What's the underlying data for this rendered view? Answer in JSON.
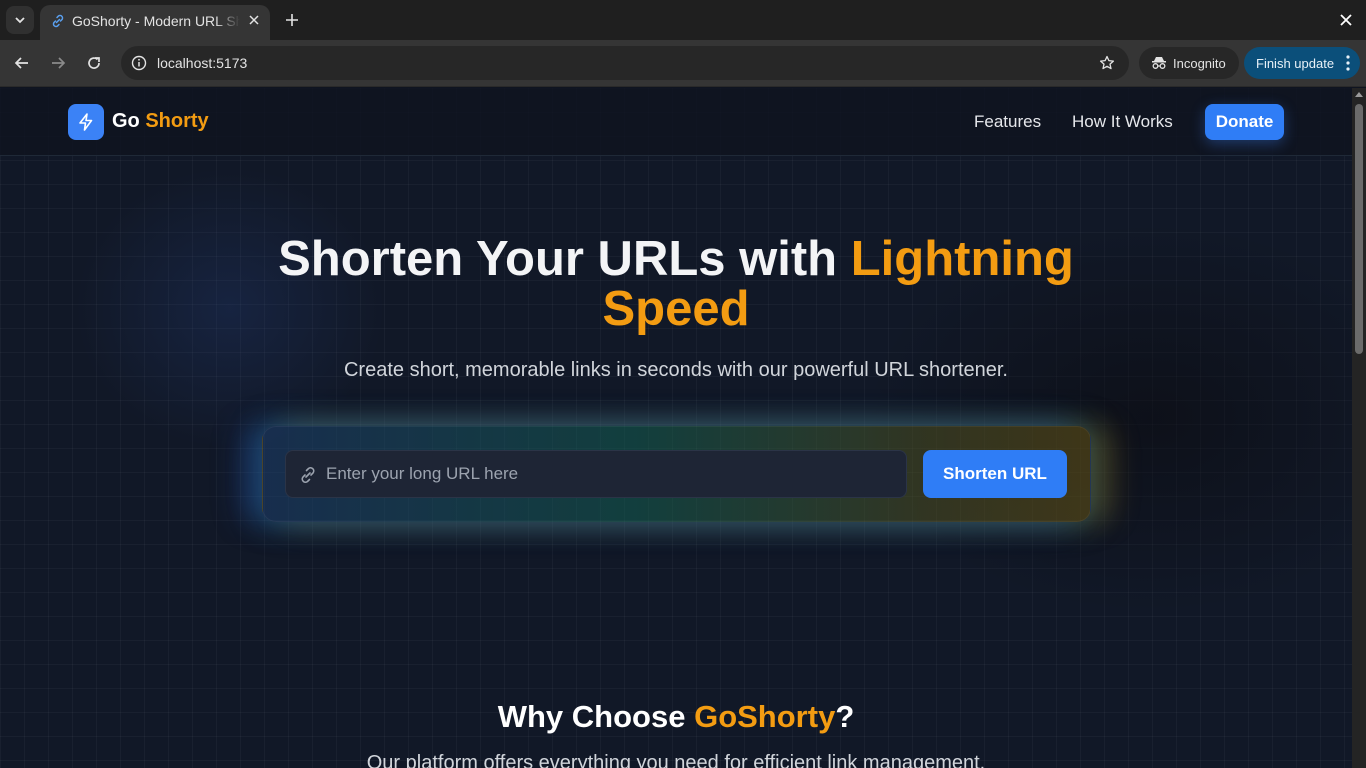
{
  "browser": {
    "tab_title": "GoShorty - Modern URL Shortener",
    "url": "localhost:5173",
    "incognito_label": "Incognito",
    "update_label": "Finish update",
    "icons": [
      "tab-search-icon",
      "link-favicon-icon",
      "close-icon",
      "plus-icon",
      "back-icon",
      "forward-icon",
      "reload-icon",
      "info-icon",
      "star-icon",
      "incognito-icon",
      "kebab-menu-icon"
    ]
  },
  "header": {
    "logo_prefix": "Go",
    "logo_accent": "Shorty",
    "nav": [
      "Features",
      "How It Works"
    ],
    "donate_label": "Donate"
  },
  "hero": {
    "title_main": "Shorten Your URLs with ",
    "title_accent": "Lightning Speed",
    "subtitle": "Create short, memorable links in seconds with our powerful URL shortener.",
    "input_placeholder": "Enter your long URL here",
    "input_value": "",
    "button_label": "Shorten URL"
  },
  "why": {
    "title_prefix": "Why Choose ",
    "title_accent": "GoShorty",
    "title_suffix": "?",
    "subtitle": "Our platform offers everything you need for efficient link management."
  },
  "colors": {
    "accent_orange": "#f39c12",
    "primary_blue": "#2f7df6",
    "page_bg": "#111827"
  }
}
